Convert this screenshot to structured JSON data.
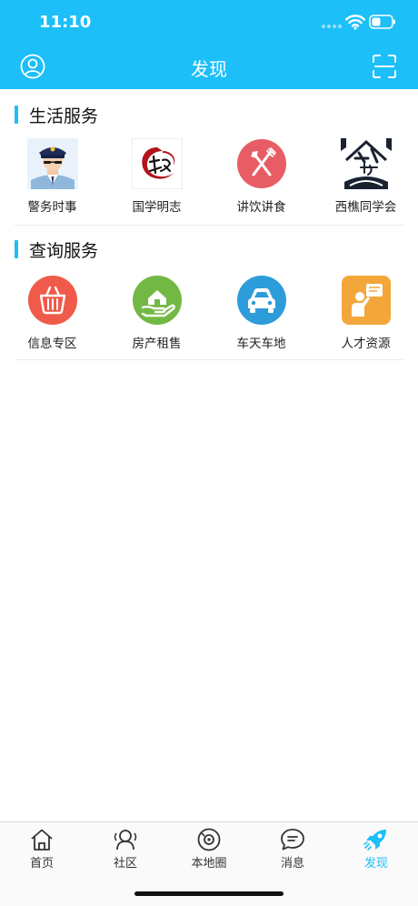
{
  "status_bar": {
    "time": "11:10"
  },
  "header": {
    "title": "发现",
    "left_icon": "user-circle-icon",
    "right_icon": "scan-icon"
  },
  "sections": {
    "life": {
      "title": "生活服务",
      "items": [
        {
          "label": "警务时事",
          "icon": "police-officer-icon"
        },
        {
          "label": "国学明志",
          "icon": "guoxue-logo-icon"
        },
        {
          "label": "讲饮讲食",
          "icon": "fork-knife-icon"
        },
        {
          "label": "西樵同学会",
          "icon": "alumni-logo-icon"
        }
      ]
    },
    "query": {
      "title": "查询服务",
      "items": [
        {
          "label": "信息专区",
          "icon": "basket-icon"
        },
        {
          "label": "房产租售",
          "icon": "house-hand-icon"
        },
        {
          "label": "车天车地",
          "icon": "car-icon"
        },
        {
          "label": "人才资源",
          "icon": "person-board-icon"
        }
      ]
    }
  },
  "tabbar": {
    "active_color": "#1CBFF8",
    "tabs": [
      {
        "label": "首页",
        "icon": "home-icon"
      },
      {
        "label": "社区",
        "icon": "community-icon"
      },
      {
        "label": "本地圈",
        "icon": "local-circle-icon"
      },
      {
        "label": "消息",
        "icon": "message-icon"
      },
      {
        "label": "发现",
        "icon": "discover-rocket-icon"
      }
    ]
  }
}
